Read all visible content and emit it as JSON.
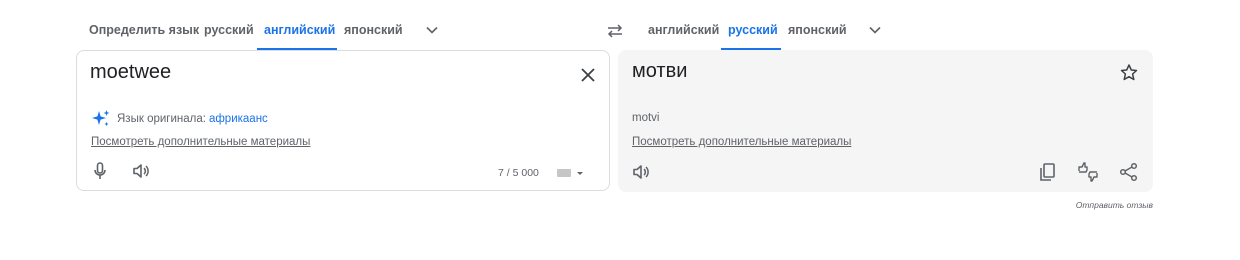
{
  "source_tabs": [
    "Определить язык",
    "русский",
    "английский",
    "японский"
  ],
  "target_tabs": [
    "английский",
    "русский",
    "японский"
  ],
  "source": {
    "text": "moetwee",
    "detect_label": "Язык оригинала:",
    "detect_language": "африкаанс",
    "more_link": "Посмотреть дополнительные материалы",
    "counter": "7 / 5 000"
  },
  "target": {
    "text": "мотви",
    "transliteration": "motvi",
    "more_link": "Посмотреть дополнительные материалы"
  },
  "feedback": "Отправить отзыв",
  "colors": {
    "accent": "#1a73e8",
    "text": "#5f6368",
    "panel": "#f5f5f5"
  },
  "icons": [
    "chevron-down-icon",
    "swap-icon",
    "close-icon",
    "sparkle-icon",
    "mic-icon",
    "speaker-icon",
    "keyboard-icon",
    "star-icon",
    "copy-icon",
    "rate-icon",
    "share-icon"
  ]
}
